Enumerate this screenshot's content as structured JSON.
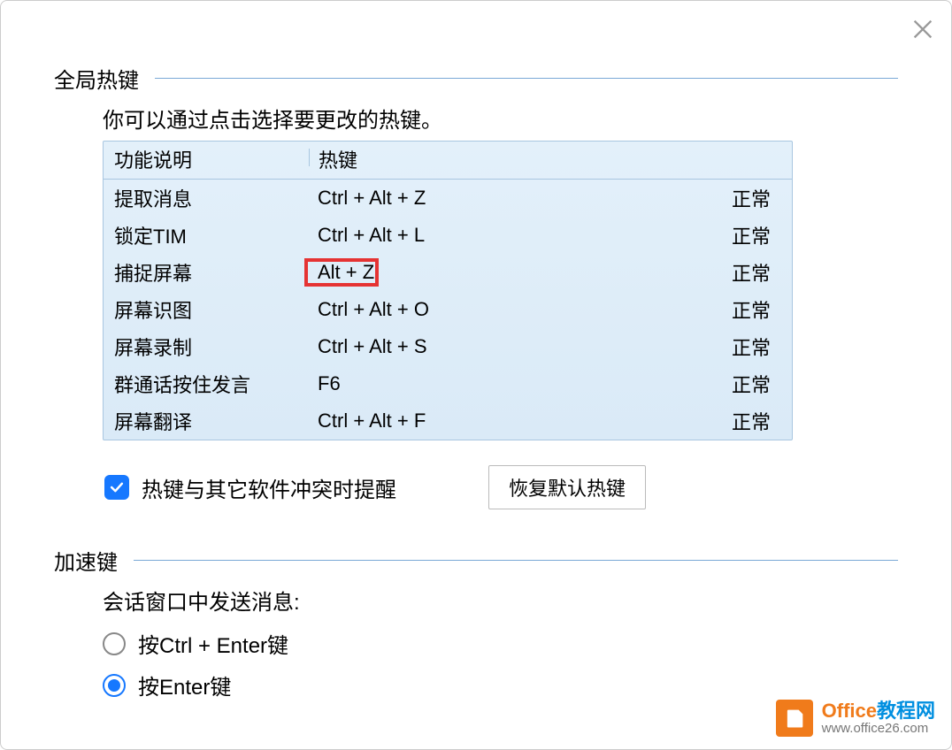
{
  "close_label": "关闭",
  "global": {
    "title": "全局热键",
    "instruction": "你可以通过点击选择要更改的热键。",
    "headers": {
      "func": "功能说明",
      "key": "热键"
    },
    "rows": [
      {
        "func": "提取消息",
        "key": "Ctrl + Alt + Z",
        "status": "正常"
      },
      {
        "func": "锁定TIM",
        "key": "Ctrl + Alt + L",
        "status": "正常"
      },
      {
        "func": "捕捉屏幕",
        "key": "Alt + Z",
        "status": "正常",
        "highlighted": true
      },
      {
        "func": "屏幕识图",
        "key": "Ctrl + Alt + O",
        "status": "正常"
      },
      {
        "func": "屏幕录制",
        "key": "Ctrl + Alt + S",
        "status": "正常"
      },
      {
        "func": "群通话按住发言",
        "key": "F6",
        "status": "正常"
      },
      {
        "func": "屏幕翻译",
        "key": "Ctrl + Alt + F",
        "status": "正常"
      }
    ],
    "conflict_label": "热键与其它软件冲突时提醒",
    "conflict_checked": true,
    "restore_label": "恢复默认热键"
  },
  "accel": {
    "title": "加速键",
    "send_label": "会话窗口中发送消息:",
    "options": [
      {
        "label": "按Ctrl + Enter键",
        "checked": false
      },
      {
        "label": "按Enter键",
        "checked": true
      }
    ]
  },
  "watermark": {
    "brand_en": "Office",
    "brand_cn": "教程网",
    "url": "www.office26.com"
  }
}
